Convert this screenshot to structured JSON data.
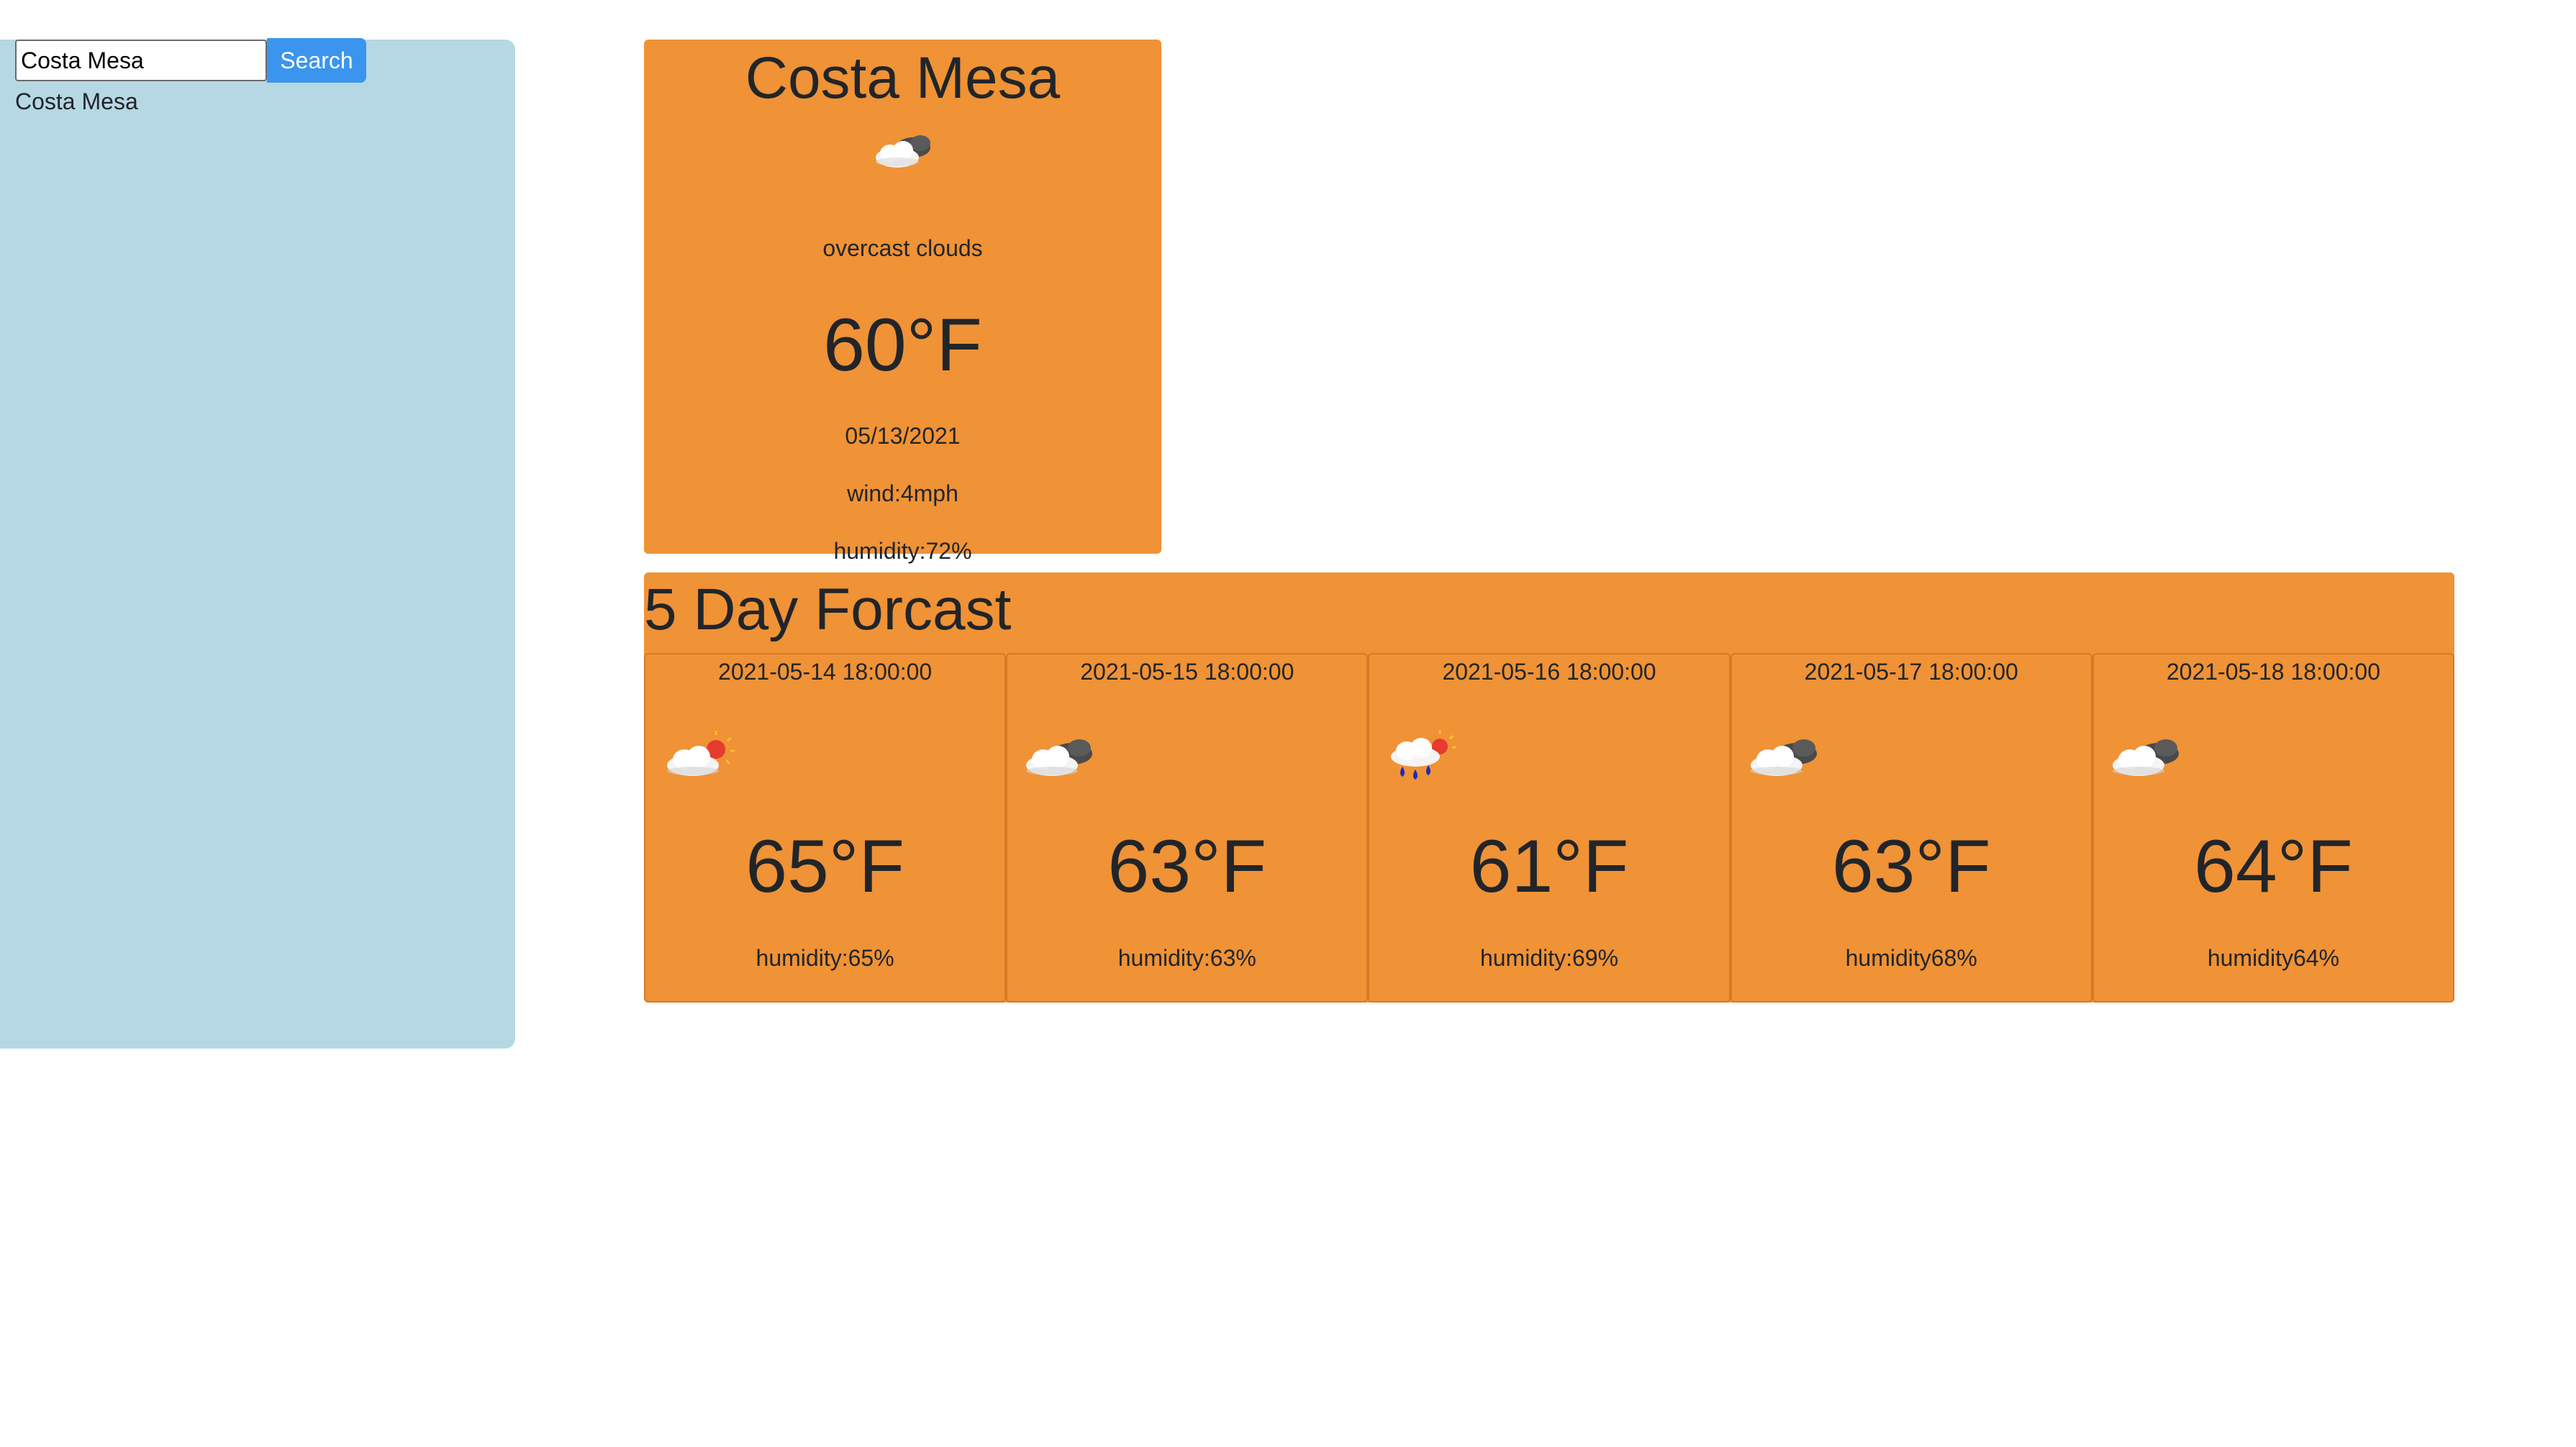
{
  "search": {
    "input_value": "Costa Mesa",
    "button_label": "Search",
    "history": [
      "Costa Mesa"
    ]
  },
  "current": {
    "city": "Costa Mesa",
    "icon": "overcast-clouds-icon",
    "description": "overcast clouds",
    "temperature": "60°F",
    "date": "05/13/2021",
    "wind": "wind:4mph",
    "humidity": "humidity:72%"
  },
  "forecast": {
    "title": "5 Day Forcast",
    "days": [
      {
        "datetime": "2021-05-14 18:00:00",
        "icon": "few-clouds-icon",
        "temperature": "65°F",
        "humidity": "humidity:65%"
      },
      {
        "datetime": "2021-05-15 18:00:00",
        "icon": "broken-clouds-icon",
        "temperature": "63°F",
        "humidity": "humidity:63%"
      },
      {
        "datetime": "2021-05-16 18:00:00",
        "icon": "rain-icon",
        "temperature": "61°F",
        "humidity": "humidity:69%"
      },
      {
        "datetime": "2021-05-17 18:00:00",
        "icon": "broken-clouds-icon",
        "temperature": "63°F",
        "humidity": "humidity68%"
      },
      {
        "datetime": "2021-05-18 18:00:00",
        "icon": "broken-clouds-icon",
        "temperature": "64°F",
        "humidity": "humidity64%"
      }
    ]
  },
  "colors": {
    "sidebar_bg": "#b6d8e4",
    "card_bg": "#f09236",
    "button_bg": "#3b95ee"
  }
}
